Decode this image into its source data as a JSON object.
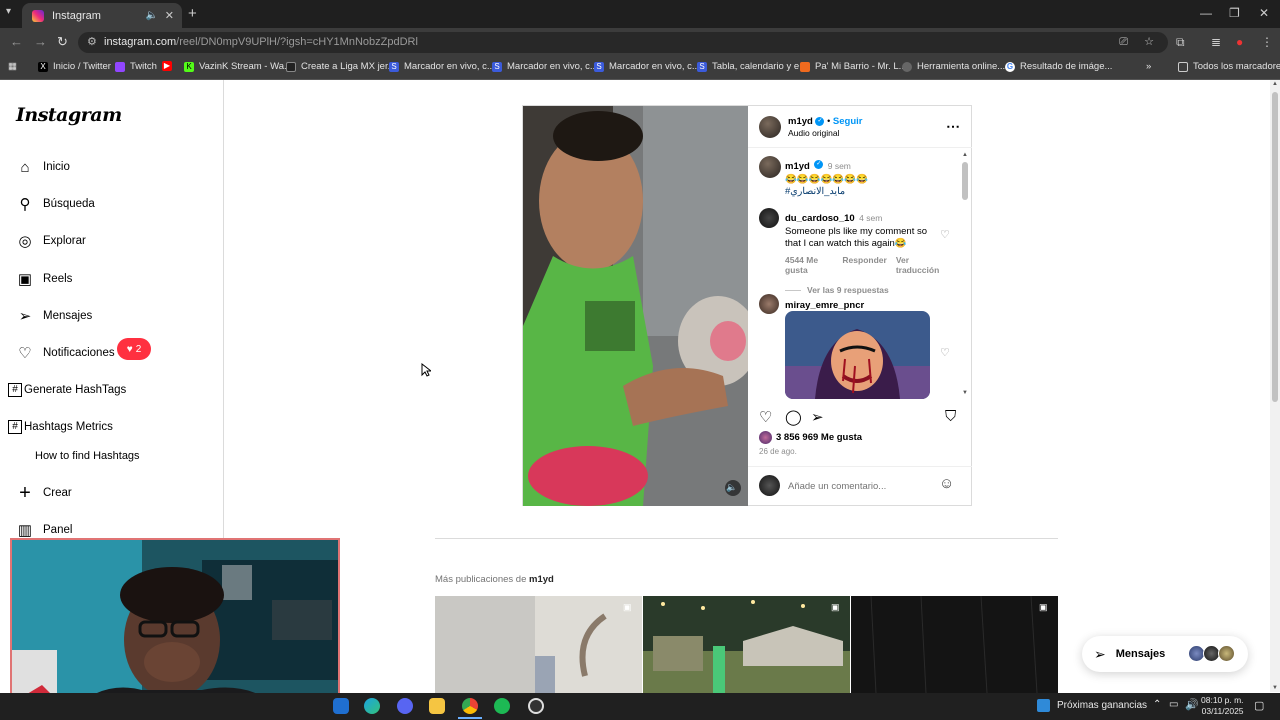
{
  "browser": {
    "tab_title": "Instagram",
    "url_host": "instagram.com",
    "url_path": "/reel/DN0mpV9UPlH/?igsh=cHY1MnNobzZpdDRl",
    "bookmarks": [
      "Inicio / Twitter",
      "Twitch",
      "",
      "VazinK Stream - Wa...",
      "Create a Liga MX jer...",
      "Marcador en vivo, c...",
      "Marcador en vivo, c...",
      "Marcador en vivo, c...",
      "Tabla, calendario y e...",
      "Pa' Mi Barrio - Mr. L...",
      "Herramienta online...",
      "Resultado de imáge..."
    ],
    "all_bookmarks": "Todos los marcadores"
  },
  "sidebar": {
    "logo": "Instagram",
    "items": [
      {
        "label": "Inicio",
        "icon": "home-icon"
      },
      {
        "label": "Búsqueda",
        "icon": "search-icon"
      },
      {
        "label": "Explorar",
        "icon": "compass-icon"
      },
      {
        "label": "Reels",
        "icon": "reels-icon"
      },
      {
        "label": "Mensajes",
        "icon": "send-icon"
      },
      {
        "label": "Notificaciones",
        "icon": "heart-icon"
      }
    ],
    "notif_count": "2",
    "ext_items": [
      "Generate HashTags",
      "Hashtags Metrics"
    ],
    "how_to": "How to find Hashtags",
    "create": "Crear",
    "panel": "Panel"
  },
  "post": {
    "author": "m1yd",
    "follow": "Seguir",
    "audio": "Audio original",
    "caption": {
      "author": "m1yd",
      "time": "9 sem",
      "emoji": "😂😂😂😂😂😂😂",
      "hashtag": "#مايد_الانصاري"
    },
    "comments": [
      {
        "author": "du_cardoso_10",
        "time": "4 sem",
        "text1": "Someone pls like my comment so",
        "text2": "that I can watch this again😂",
        "likes": "4544 Me gusta",
        "reply": "Responder",
        "translate": "Ver traducción",
        "view_replies": "Ver las 9 respuestas"
      },
      {
        "author": "miray_emre_pncr"
      }
    ],
    "likes": "3 856 969 Me gusta",
    "date": "26 de ago.",
    "comment_placeholder": "Añade un comentario..."
  },
  "more_posts": {
    "label": "Más publicaciones de",
    "author": "m1yd"
  },
  "messages_pill": "Mensajes",
  "taskbar": {
    "news": "Próximas ganancias",
    "time": "08:10 p. m.",
    "date": "03/11/2025"
  },
  "colors": {
    "instagram_blue": "#0095f6",
    "notif_red": "#ff3040",
    "browser_dark": "#3c3c3c",
    "taskbar": "#202020"
  }
}
